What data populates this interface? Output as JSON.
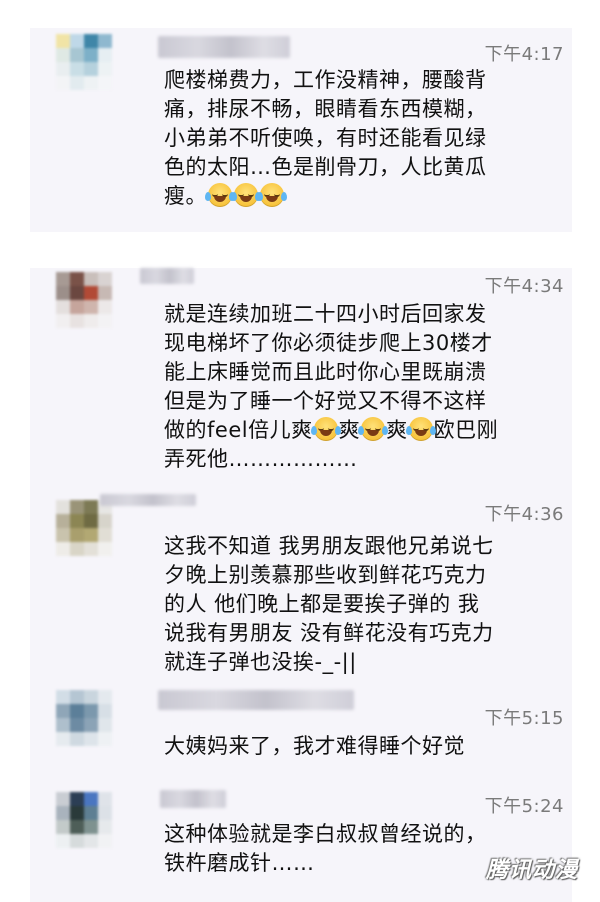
{
  "messages": [
    {
      "time": "下午4:17",
      "lines": [
        "爬楼梯费力，工作没精神，腰酸背",
        "痛，排尿不畅，眼睛看东西模糊，",
        "小弟弟不听使唤，有时还能看见绿",
        "色的太阳…色是削骨刀，人比黄瓜",
        "瘦。"
      ]
    },
    {
      "time": "下午4:34",
      "lines": [
        "就是连续加班二十四小时后回家发",
        "现电梯坏了你必须徒步爬上30楼才",
        "能上床睡觉而且此时你心里既崩溃",
        "但是为了睡一个好觉又不得不这样"
      ],
      "line5_parts": [
        "做的feel倍儿爽",
        "爽",
        "爽",
        "欧巴刚"
      ],
      "line6": "弄死他………………"
    },
    {
      "time": "下午4:36",
      "lines": [
        "这我不知道 我男朋友跟他兄弟说七",
        "夕晚上别羡慕那些收到鲜花巧克力",
        "的人 他们晚上都是要挨子弹的  我",
        "说我有男朋友 没有鲜花没有巧克力",
        "就连子弹也没挨-_-||"
      ]
    },
    {
      "time": "下午5:15",
      "lines": [
        "大姨妈来了，我才难得睡个好觉"
      ]
    },
    {
      "time": "下午5:24",
      "lines": [
        "这种体验就是李白叔叔曾经说的，",
        "铁杵磨成针……"
      ]
    }
  ],
  "emoji_name": "face-with-tears-of-joy",
  "watermark": "腾讯动漫",
  "colors": {
    "card_bg": "#f6f5fa",
    "text": "#111111",
    "time": "#7a7a7a"
  }
}
